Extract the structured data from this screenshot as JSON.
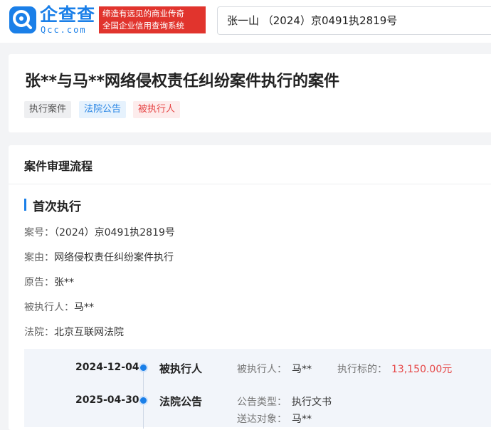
{
  "header": {
    "logo_text": "企查查",
    "logo_sub": "Qcc.com",
    "slogan_line1": "缔造有远见的商业传奇",
    "slogan_line2": "全国企业信用查询系统",
    "search_value": "张一山 （2024）京0491执2819号"
  },
  "case": {
    "title": "张**与马**网络侵权责任纠纷案件执行的案件",
    "tags": [
      "执行案件",
      "法院公告",
      "被执行人"
    ]
  },
  "process": {
    "section_title": "案件审理流程",
    "stage_title": "首次执行",
    "fields": [
      {
        "label": "案号：",
        "value": "（2024）京0491执2819号"
      },
      {
        "label": "案由：",
        "value": "网络侵权责任纠纷案件执行"
      },
      {
        "label": "原告：",
        "value": "张**"
      },
      {
        "label": "被执行人：",
        "value": "马**"
      },
      {
        "label": "法院：",
        "value": "北京互联网法院"
      }
    ],
    "timeline": [
      {
        "date": "2024-12-04",
        "type": "被执行人",
        "k1": "被执行人：",
        "v1": "马**",
        "k2": "执行标的：",
        "v2": "13,150.00元"
      },
      {
        "date": "2025-04-30",
        "type": "法院公告",
        "k1": "公告类型：",
        "v1": "执行文书",
        "k2": "送达对象：",
        "v2": "马**"
      }
    ]
  },
  "colors": {
    "brand": "#1a7fe8",
    "slogan_bg": "#e1342d",
    "amount": "#e64545"
  }
}
